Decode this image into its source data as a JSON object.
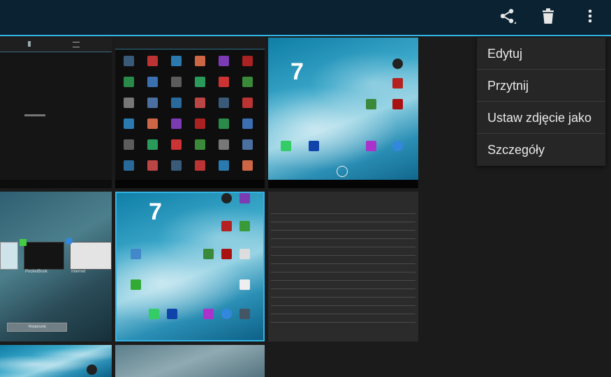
{
  "action_bar": {
    "share_icon": "share-icon",
    "delete_icon": "trash-icon",
    "overflow_icon": "overflow-menu-icon"
  },
  "overflow_menu": {
    "items": [
      "Edytuj",
      "Przytnij",
      "Ustaw zdjęcie jako",
      "Szczegóły"
    ]
  },
  "thumbnails": {
    "home_clock": "7",
    "launcher_label_1": "PocketBook",
    "launcher_label_2": "Internet",
    "launcher_label_3": "Rozpocznij"
  },
  "colors": {
    "accent": "#33b5e5",
    "action_bar": "#0b2233",
    "menu_bg": "#262626"
  }
}
